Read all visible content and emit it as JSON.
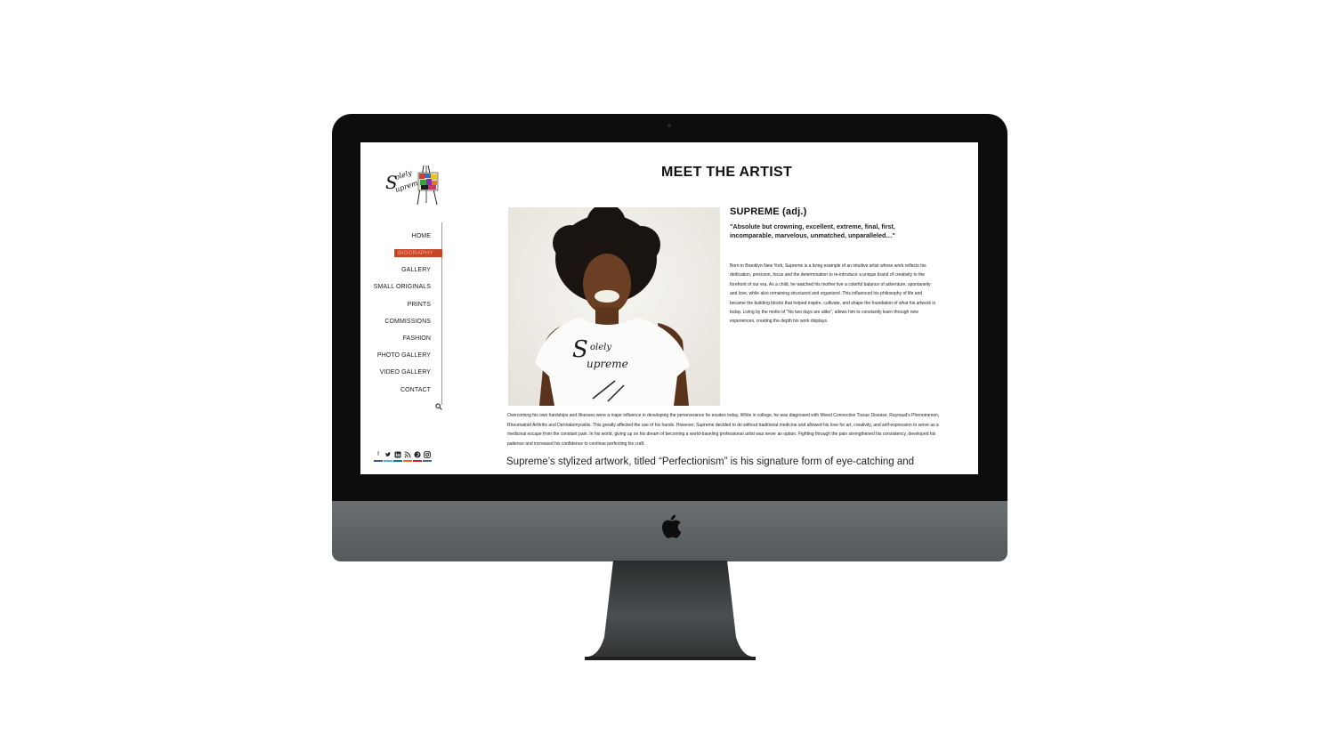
{
  "site": {
    "logo_text": "Solely Supreme",
    "page_title": "MEET THE ARTIST"
  },
  "sidebar": {
    "items": [
      {
        "label": "HOME",
        "active": false
      },
      {
        "label": "BIOGRAPHY",
        "active": true
      },
      {
        "label": "GALLERY",
        "active": false
      },
      {
        "label": "SMALL ORIGINALS",
        "active": false
      },
      {
        "label": "PRINTS",
        "active": false
      },
      {
        "label": "COMMISSIONS",
        "active": false
      },
      {
        "label": "FASHION",
        "active": false
      },
      {
        "label": "PHOTO GALLERY",
        "active": false
      },
      {
        "label": "VIDEO GALLERY",
        "active": false
      },
      {
        "label": "CONTACT",
        "active": false
      }
    ],
    "social": [
      "facebook-icon",
      "twitter-icon",
      "linkedin-icon",
      "rss-icon",
      "pinterest-icon",
      "instagram-icon"
    ],
    "accent_color": "#c84526"
  },
  "content": {
    "heading": "SUPREME (adj.)",
    "quote": "\"Absolute but crowning, excellent, extreme, final, first, incomparable, marvelous, unmatched, unparalleled…\"",
    "bio_1": "Born in Brooklyn New York, Supreme is a living example of an intuitive artist whose work reflects his dedication, precision, focus and the determination to re-introduce a unique brand of creativity to the forefront of our era. As a child, he watched his mother live a colorful balance of adventure, spontaneity and love, while also remaining structured and organized. This influenced his philosophy of life and became the building blocks that helped inspire, cultivate, and shape the foundation of what his artwork is today. Living by the motto of \"No two days are alike\", allows him to constantly learn through new experiences, creating the depth his work displays.",
    "bio_2": "Overcoming his own hardships and illnesses were a major influence in developing the perseverance he exudes today. While in college, he was diagnosed with Mixed Connective Tissue Disease, Raynaud's Phenomenon, Rheumatoid Arthritis and Dermatomyositis. This greatly affected the use of his hands. However, Supreme decided to do without traditional medicine and allowed his love for art, creativity, and self-expression to serve as a medicinal escape from the constant pain. In his world, giving up on his dream of becoming a world-traveling professional artist was never an option. Fighting through the pain strengthened his consistency, developed his patience and increased his confidence to continue perfecting his craft.",
    "lead": "Supreme’s stylized artwork, titled “Perfectionism” is his signature form of eye-catching and"
  }
}
